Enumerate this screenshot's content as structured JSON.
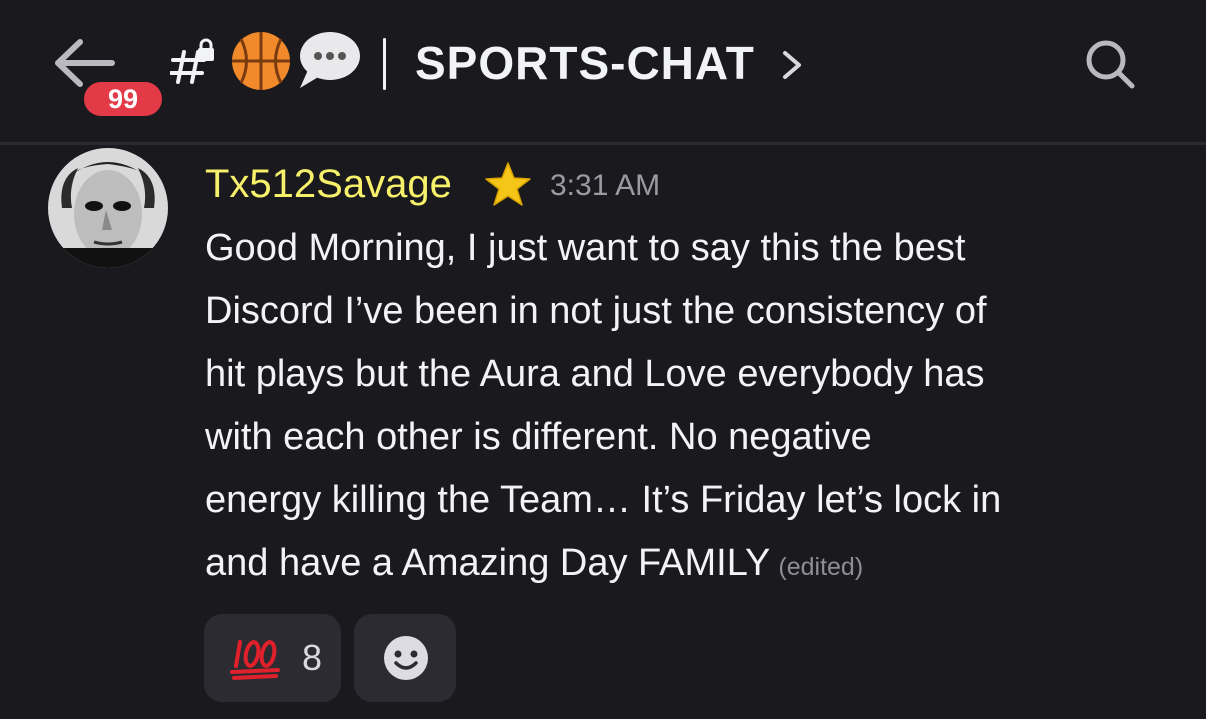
{
  "header": {
    "back_icon": "arrow-left-icon",
    "unread_badge": "99",
    "channel_icon": "locked-text-channel-icon",
    "channel_emojis": [
      "basketball-icon",
      "speech-bubble-icon"
    ],
    "separator": "|",
    "channel_title": "SPORTS-CHAT",
    "chevron_icon": "chevron-right-icon",
    "search_icon": "search-icon"
  },
  "message": {
    "avatar": "michael-myers-mask-avatar",
    "username": "Tx512Savage",
    "username_color": "#f7f06a",
    "role_icon": "star-icon",
    "timestamp": "3:31 AM",
    "lines": [
      "Good Morning, I just want to say this the best",
      "Discord I’ve been in not just the consistency of",
      "hit plays but the Aura and Love everybody has",
      "with each other is different. No negative",
      "energy killing the Team… It’s Friday let’s lock in",
      "and have a Amazing Day FAMILY"
    ],
    "edited_label": "(edited)"
  },
  "reactions": [
    {
      "emoji": "hundred-points-icon",
      "count": "8"
    }
  ],
  "add_reaction_icon": "add-reaction-smiley-icon",
  "colors": {
    "background": "#1a1a1e",
    "badge": "#e23a47",
    "pill": "#2b2b31",
    "star": "#f5c518"
  }
}
